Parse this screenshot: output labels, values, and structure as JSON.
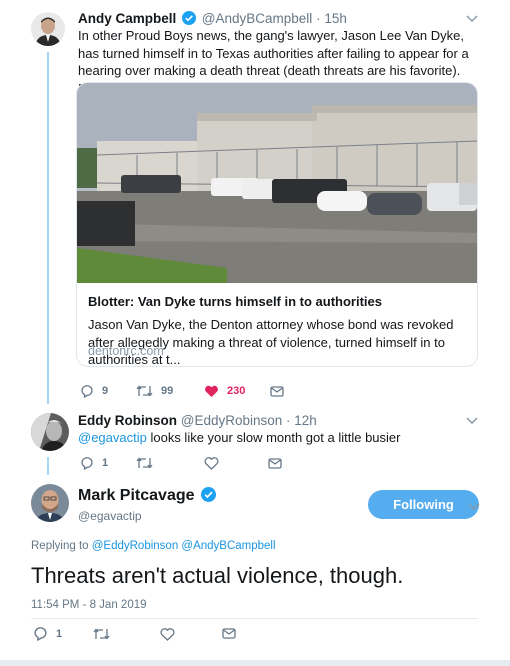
{
  "tweet1": {
    "name": "Andy Campbell",
    "handle": "@AndyBCampbell",
    "time": "· 15h",
    "text": "In other Proud Boys news, the gang's lawyer, Jason Lee Van Dyke, has turned himself in to Texas authorities after failing to appear for a hearing over making a death threat (death threats are his favorite). BIG DAY for the Proud Boys",
    "card": {
      "title": "Blotter: Van Dyke turns himself in to authorities",
      "description": "Jason Van Dyke, the Denton attorney whose bond was revoked after allegedly making a threat of violence, turned himself in to authorities at t...",
      "domain": "dentonrc.com"
    },
    "replies": "9",
    "retweets": "99",
    "likes": "230"
  },
  "tweet2": {
    "name": "Eddy Robinson",
    "handle": "@EddyRobinson",
    "time": "· 12h",
    "mention": "@egavactip",
    "text": " looks like your slow month got a little busier",
    "replies": "1"
  },
  "tweet3": {
    "name": "Mark Pitcavage",
    "handle": "@egavactip",
    "follow_label": "Following",
    "replying_prefix": "Replying to ",
    "replying_to": "@EddyRobinson @AndyBCampbell",
    "text": "Threats aren't actual violence, though.",
    "timestamp": "11:54 PM - 8 Jan 2019",
    "replies": "1"
  },
  "colors": {
    "accent": "#1da1f2",
    "like": "#e0245e",
    "follow": "#55acee",
    "thread": "#a6d6f2"
  },
  "icons": [
    "reply-icon",
    "retweet-icon",
    "like-icon",
    "dm-icon",
    "verified-icon",
    "caret-down-icon"
  ]
}
